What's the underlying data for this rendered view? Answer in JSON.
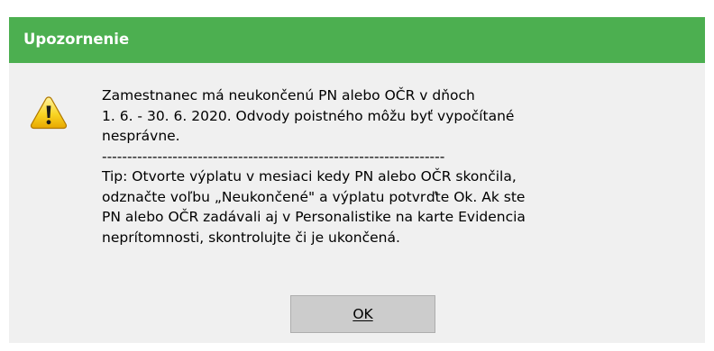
{
  "dialog": {
    "title": "Upozornenie",
    "colors": {
      "title_bar": "#4caf50",
      "body_background": "#f0f0f0",
      "button_background": "#cccccc"
    },
    "icon": "warning-icon",
    "message": {
      "line1": "Zamestnanec má neukončenú PN alebo OČR v dňoch",
      "line2": "1. 6. - 30. 6. 2020. Odvody poistného môžu byť vypočítané",
      "line3": "nesprávne.",
      "separator": "--------------------------------------------------------------------",
      "tip1": "Tip: Otvorte výplatu v mesiaci kedy PN alebo OČR skončila,",
      "tip2": "odznačte voľbu „Neukončené\" a výplatu potvrďte Ok. Ak ste",
      "tip3": "PN alebo OČR zadávali aj v Personalistike na karte Evidencia",
      "tip4": "neprítomnosti, skontrolujte či je ukončená."
    },
    "ok_label": "OK"
  }
}
